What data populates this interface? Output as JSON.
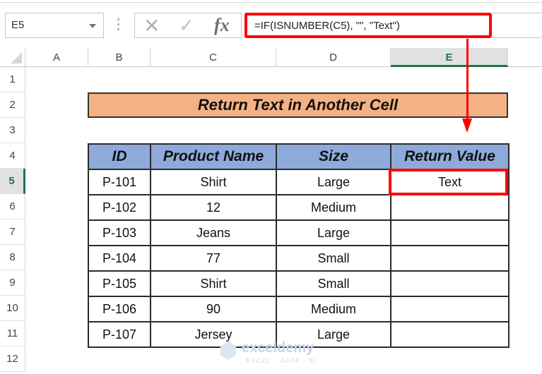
{
  "formula_bar": {
    "name_box": "E5",
    "cancel_icon": "✕",
    "enter_icon": "✓",
    "fx_label": "fx",
    "formula": "=IF(ISNUMBER(C5), \"\", \"Text\")"
  },
  "columns": [
    "A",
    "B",
    "C",
    "D",
    "E"
  ],
  "selected_column": "E",
  "rows": [
    "1",
    "2",
    "3",
    "4",
    "5",
    "6",
    "7",
    "8",
    "9",
    "10",
    "11",
    "12"
  ],
  "selected_row": "5",
  "sheet": {
    "title": "Return Text in Another Cell",
    "headers": [
      "ID",
      "Product Name",
      "Size",
      "Return Value"
    ],
    "data": [
      [
        "P-101",
        "Shirt",
        "Large",
        "Text"
      ],
      [
        "P-102",
        "12",
        "Medium",
        ""
      ],
      [
        "P-103",
        "Jeans",
        "Large",
        ""
      ],
      [
        "P-104",
        "77",
        "Small",
        ""
      ],
      [
        "P-105",
        "Shirt",
        "Small",
        ""
      ],
      [
        "P-106",
        "90",
        "Medium",
        ""
      ],
      [
        "P-107",
        "Jersey",
        "Large",
        ""
      ]
    ]
  },
  "colors": {
    "title_fill": "#f4b183",
    "header_fill": "#8eaadb",
    "highlight": "#ff0000",
    "excel_green": "#217346"
  },
  "watermark": {
    "name": "exceldemy",
    "tagline": "EXCEL · DATA · BI"
  }
}
